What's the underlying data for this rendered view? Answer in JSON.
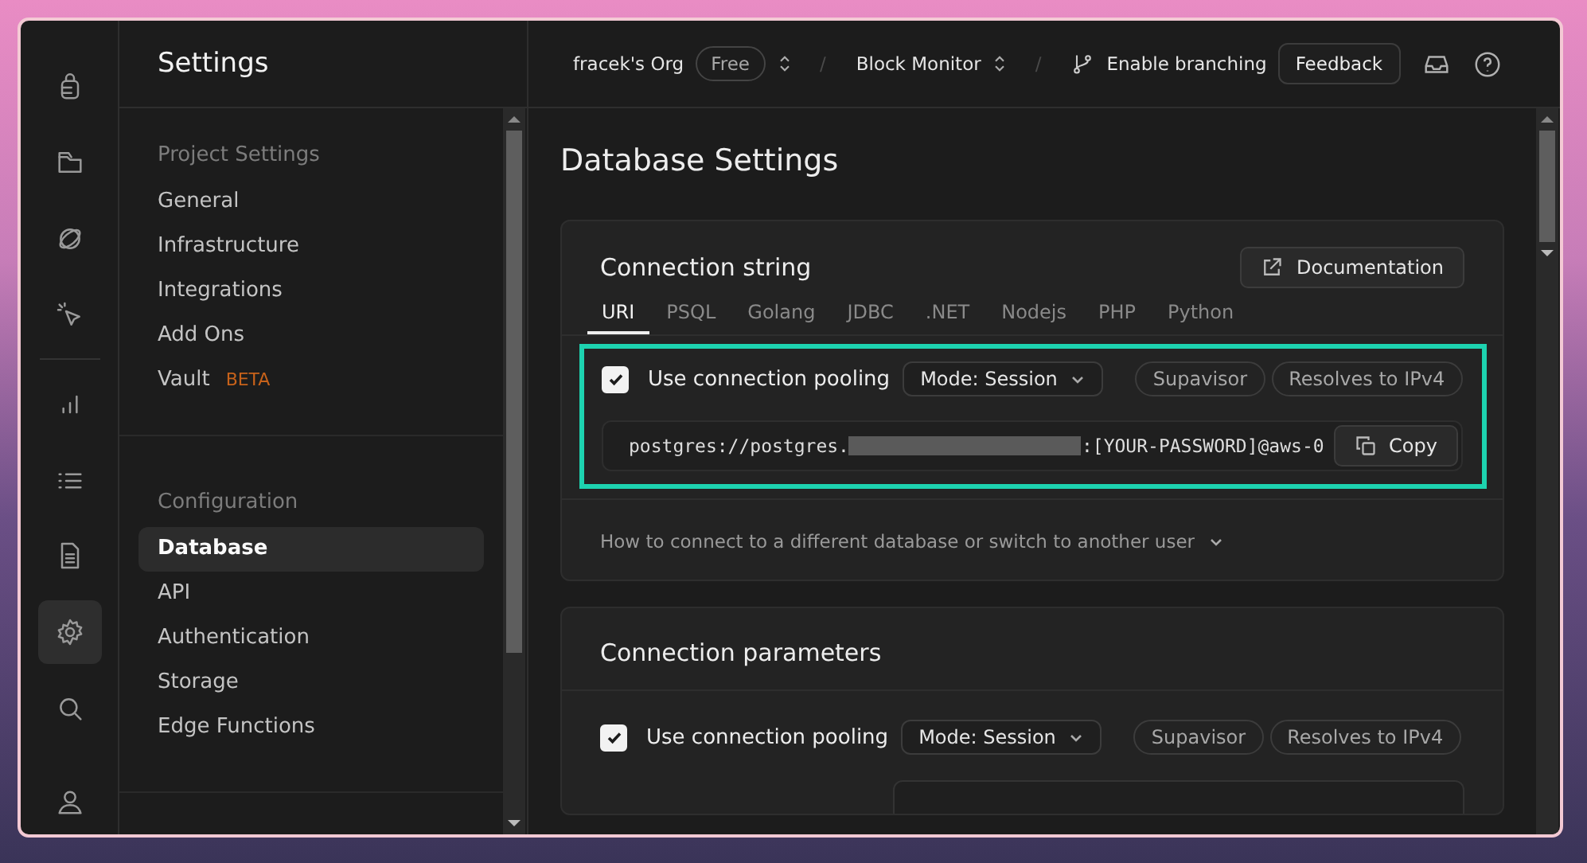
{
  "rail": {
    "items": [
      {
        "kind": "database",
        "selected": false
      },
      {
        "kind": "folder",
        "selected": false
      },
      {
        "kind": "orbit",
        "selected": false
      },
      {
        "kind": "pointer",
        "selected": false
      },
      {
        "kind": "chart",
        "selected": false
      },
      {
        "kind": "list",
        "selected": false
      },
      {
        "kind": "document",
        "selected": false
      },
      {
        "kind": "gear",
        "selected": true
      },
      {
        "kind": "search",
        "selected": false
      },
      {
        "kind": "user",
        "selected": false
      }
    ]
  },
  "sidebar": {
    "title": "Settings",
    "groups": [
      {
        "heading": "Project Settings",
        "items": [
          {
            "label": "General",
            "selected": false
          },
          {
            "label": "Infrastructure",
            "selected": false
          },
          {
            "label": "Integrations",
            "selected": false
          },
          {
            "label": "Add Ons",
            "selected": false
          },
          {
            "label": "Vault",
            "badge": "BETA",
            "selected": false
          }
        ]
      },
      {
        "heading": "Configuration",
        "items": [
          {
            "label": "Database",
            "selected": true
          },
          {
            "label": "API",
            "selected": false
          },
          {
            "label": "Authentication",
            "selected": false
          },
          {
            "label": "Storage",
            "selected": false
          },
          {
            "label": "Edge Functions",
            "selected": false
          }
        ]
      }
    ]
  },
  "header": {
    "org": "fracek's Org",
    "plan": "Free",
    "separator": "/",
    "project": "Block Monitor",
    "branching": "Enable branching",
    "feedback": "Feedback"
  },
  "page_title": "Database Settings",
  "connection_string": {
    "title": "Connection string",
    "documentation": "Documentation",
    "tabs": [
      {
        "label": "URI",
        "selected": true
      },
      {
        "label": "PSQL",
        "selected": false
      },
      {
        "label": "Golang",
        "selected": false
      },
      {
        "label": "JDBC",
        "selected": false
      },
      {
        "label": ".NET",
        "selected": false
      },
      {
        "label": "Nodejs",
        "selected": false
      },
      {
        "label": "PHP",
        "selected": false
      },
      {
        "label": "Python",
        "selected": false
      }
    ],
    "pooling": {
      "label": "Use connection pooling",
      "checked": true,
      "mode": "Mode: Session",
      "tags": [
        "Supavisor",
        "Resolves to IPv4"
      ]
    },
    "uri_start": "postgres://postgres.",
    "uri_end": ":[YOUR-PASSWORD]@aws-0",
    "copy": "Copy",
    "help": "How to connect to a different database or switch to another user"
  },
  "connection_parameters": {
    "title": "Connection parameters",
    "pooling": {
      "label": "Use connection pooling",
      "checked": true,
      "mode": "Mode: Session",
      "tags": [
        "Supavisor",
        "Resolves to IPv4"
      ]
    }
  }
}
